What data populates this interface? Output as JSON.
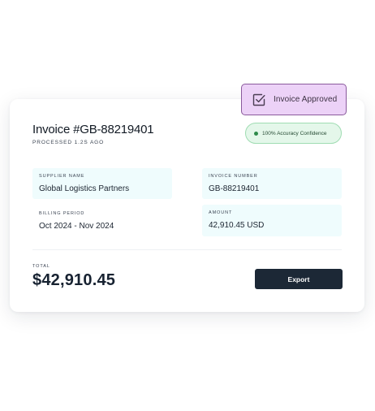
{
  "status_badge": {
    "label": "Invoice Approved",
    "icon": "checkbox-checked-icon",
    "color": "#ecd2f7"
  },
  "header": {
    "title": "Invoice #GB-88219401",
    "subtitle": "PROCESSED 1.2S AGO"
  },
  "confidence": {
    "label": "100% Accuracy Confidence",
    "color": "#2e8a4a"
  },
  "fields": {
    "supplier": {
      "label": "SUPPLIER NAME",
      "value": "Global Logistics Partners"
    },
    "invoice_number": {
      "label": "INVOICE NUMBER",
      "value": "GB-88219401"
    },
    "billing_period": {
      "label": "BILLING PERIOD",
      "value": "Oct 2024 - Nov 2024"
    },
    "amount": {
      "label": "AMOUNT",
      "value": "42,910.45 USD"
    }
  },
  "total": {
    "label": "TOTAL",
    "value": "$42,910.45"
  },
  "actions": {
    "export_label": "Export"
  }
}
